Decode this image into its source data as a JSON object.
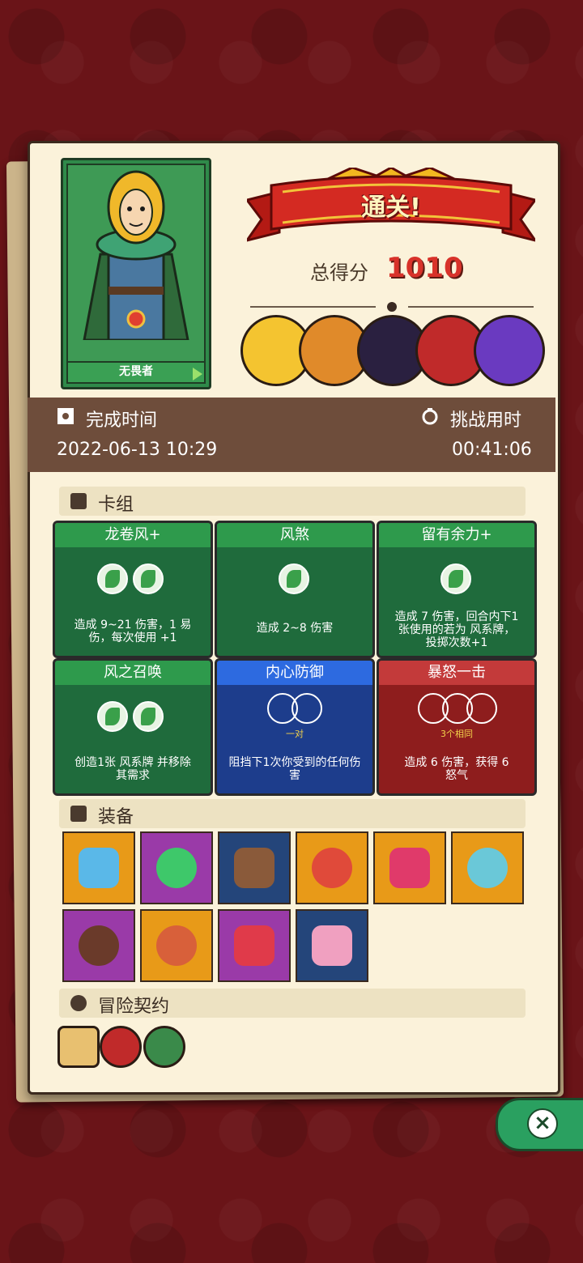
{
  "header": {
    "hero_name": "无畏者",
    "banner_text": "通关!",
    "score_label": "总得分",
    "score_value": "1010"
  },
  "bosses": [
    {
      "icon": "wizard-portrait-icon",
      "color": "#f4c430"
    },
    {
      "icon": "warrior-portrait-icon",
      "color": "#e08a2a"
    },
    {
      "icon": "dark-knight-portrait-icon",
      "color": "#2a2040"
    },
    {
      "icon": "samurai-demon-portrait-icon",
      "color": "#c02a2a"
    },
    {
      "icon": "shadow-demon-portrait-icon",
      "color": "#6a3ac0"
    }
  ],
  "time": {
    "finish_label": "完成时间",
    "finish_value": "2022-06-13 10:29",
    "challenge_label": "挑战用时",
    "challenge_value": "00:41:06"
  },
  "sections": {
    "deck": "卡组",
    "equipment": "装备",
    "contract": "冒险契约"
  },
  "cards": [
    {
      "title": "龙卷风+",
      "desc1": "造成 9~21 伤害，1 易",
      "desc2": "伤，每次使用 +1",
      "color": "green"
    },
    {
      "title": "风煞",
      "desc1": "造成 2~8 伤害",
      "desc2": "",
      "color": "green"
    },
    {
      "title": "留有余力+",
      "desc1": "造成 7 伤害，回合内下1",
      "desc2": "张使用的若为 风系牌，",
      "desc3": "投掷次数+1",
      "color": "green"
    },
    {
      "title": "风之召唤",
      "desc1": "创造1张 风系牌 并移除",
      "desc2": "其需求",
      "color": "green"
    },
    {
      "title": "内心防御",
      "sub": "一对",
      "desc1": "阻挡下1次你受到的任何伤",
      "desc2": "害",
      "color": "blue"
    },
    {
      "title": "暴怒一击",
      "sub": "3个相同",
      "desc1": "造成 6 伤害，获得 6",
      "desc2": "怒气",
      "color": "red"
    }
  ],
  "equipment": [
    {
      "icon": "ice-shield-icon",
      "bg": "orange"
    },
    {
      "icon": "green-leaf-gem-icon",
      "bg": "purple"
    },
    {
      "icon": "horn-icon",
      "bg": "navy"
    },
    {
      "icon": "rainbow-dragon-orb-icon",
      "bg": "orange"
    },
    {
      "icon": "demon-mask-icon",
      "bg": "orange"
    },
    {
      "icon": "porcelain-vase-icon",
      "bg": "orange"
    },
    {
      "icon": "wooden-button-icon",
      "bg": "purple"
    },
    {
      "icon": "meat-leg-icon",
      "bg": "orange"
    },
    {
      "icon": "ruby-pendant-icon",
      "bg": "purple"
    },
    {
      "icon": "pink-dice-icon",
      "bg": "navy"
    }
  ],
  "contracts": [
    {
      "icon": "scroll-icon"
    },
    {
      "icon": "red-knot-rune-icon"
    },
    {
      "icon": "pink-flower-rune-icon"
    }
  ]
}
